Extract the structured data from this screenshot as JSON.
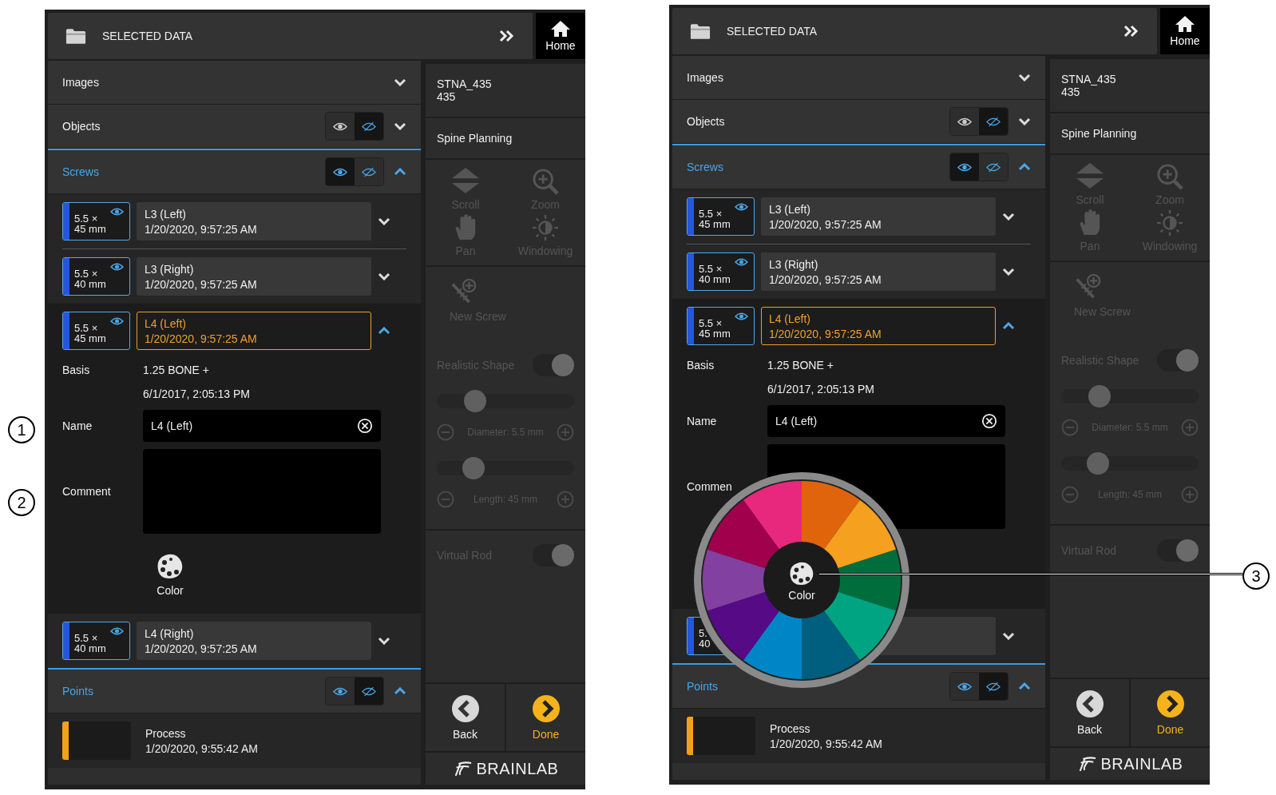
{
  "callouts": [
    {
      "label": "1"
    },
    {
      "label": "2"
    },
    {
      "label": "3"
    }
  ],
  "screens": [
    {
      "header": {
        "title": "SELECTED DATA",
        "home": "Home"
      },
      "sections": [
        {
          "title": "Images",
          "expanded": false
        },
        {
          "title": "Objects",
          "expanded": false,
          "shown": false
        },
        {
          "title": "Screws",
          "expanded": true,
          "shown": true
        }
      ],
      "screws": [
        {
          "size": "5.5 ×",
          "length": "45 mm",
          "name": "L3 (Left)",
          "date": "1/20/2020, 9:57:25 AM",
          "selected": false,
          "expanded": false
        },
        {
          "size": "5.5 ×",
          "length": "40 mm",
          "name": "L3 (Right)",
          "date": "1/20/2020, 9:57:25 AM",
          "selected": false,
          "expanded": false
        },
        {
          "size": "5.5 ×",
          "length": "45 mm",
          "name": "L4 (Left)",
          "date": "1/20/2020, 9:57:25 AM",
          "selected": true,
          "expanded": true
        },
        {
          "size": "5.5 ×",
          "length": "40 mm",
          "name": "L4 (Right)",
          "date": "1/20/2020, 9:57:25 AM",
          "selected": false,
          "expanded": false
        }
      ],
      "details": {
        "basis_label": "Basis",
        "basis_value": "1.25 BONE +",
        "basis_date": "6/1/2017, 2:05:13 PM",
        "name_label": "Name",
        "name_value": "L4 (Left)",
        "comment_label": "Comment",
        "color_label": "Color"
      },
      "points": {
        "title": "Points",
        "expanded": true,
        "shown": false,
        "items": [
          {
            "name": "Process",
            "date": "1/20/2020, 9:55:42 AM",
            "color": "#f5a01a"
          }
        ]
      },
      "side": {
        "patient_name": "STNA_435",
        "patient_id": "435",
        "workflow": "Spine Planning",
        "tools": [
          {
            "kind": "scroll",
            "label": "Scroll",
            "disabled": true
          },
          {
            "kind": "zoom",
            "label": "Zoom",
            "disabled": true
          },
          {
            "kind": "pan",
            "label": "Pan",
            "disabled": true
          },
          {
            "kind": "windowing",
            "label": "Windowing",
            "disabled": true
          }
        ],
        "new_screw": {
          "label": "New Screw",
          "disabled": true
        },
        "realistic_shape": {
          "label": "Realistic Shape",
          "on": true
        },
        "diameter": {
          "level": 0.28,
          "reading": "Diameter: 5.5 mm"
        },
        "length": {
          "level": 0.27,
          "reading": "Length: 45 mm"
        },
        "virtual_rod": {
          "label": "Virtual Rod",
          "on": true
        },
        "back": "Back",
        "done": "Done",
        "logo": "BRAINLAB"
      }
    },
    {
      "header": {
        "title": "SELECTED DATA",
        "home": "Home"
      },
      "sections": [
        {
          "title": "Images",
          "expanded": false
        },
        {
          "title": "Objects",
          "expanded": false,
          "shown": false
        },
        {
          "title": "Screws",
          "expanded": true,
          "shown": true
        }
      ],
      "screws": [
        {
          "size": "5.5 ×",
          "length": "45 mm",
          "name": "L3 (Left)",
          "date": "1/20/2020, 9:57:25 AM",
          "selected": false,
          "expanded": false
        },
        {
          "size": "5.5 ×",
          "length": "40 mm",
          "name": "L3 (Right)",
          "date": "1/20/2020, 9:57:25 AM",
          "selected": false,
          "expanded": false
        },
        {
          "size": "5.5 ×",
          "length": "45 mm",
          "name": "L4 (Left)",
          "date": "1/20/2020, 9:57:25 AM",
          "selected": true,
          "expanded": true
        },
        {
          "size": "5.",
          "length": "40",
          "selected": false,
          "expanded": false
        }
      ],
      "details": {
        "basis_label": "Basis",
        "basis_value": "1.25 BONE +",
        "basis_date": "6/1/2017, 2:05:13 PM",
        "name_label": "Name",
        "name_value": "L4 (Left)",
        "comment_label": "Commen"
      },
      "points": {
        "title": "Points",
        "expanded": true,
        "shown": false,
        "items": [
          {
            "name": "Process",
            "date": "1/20/2020, 9:55:42 AM",
            "color": "#f5a01a"
          }
        ]
      },
      "side": {
        "patient_name": "STNA_435",
        "patient_id": "435",
        "workflow": "Spine Planning",
        "tools": [
          {
            "kind": "scroll",
            "label": "Scroll",
            "disabled": true
          },
          {
            "kind": "zoom",
            "label": "Zoom",
            "disabled": true
          },
          {
            "kind": "pan",
            "label": "Pan",
            "disabled": true
          },
          {
            "kind": "windowing",
            "label": "Windowing",
            "disabled": true
          }
        ],
        "new_screw": {
          "label": "New Screw",
          "disabled": true
        },
        "realistic_shape": {
          "label": "Realistic Shape",
          "on": true
        },
        "diameter": {
          "level": 0.28,
          "reading": "Diameter: 5.5 mm"
        },
        "length": {
          "level": 0.27,
          "reading": "Length: 45 mm"
        },
        "virtual_rod": {
          "label": "Virtual Rod",
          "on": true
        },
        "back": "Back",
        "done": "Done",
        "logo": "BRAINLAB"
      },
      "color_wheel": {
        "label": "Color",
        "swatches": [
          {
            "color": "#e0640c"
          },
          {
            "color": "#f5a01e"
          },
          {
            "color": "#006e3c"
          },
          {
            "color": "#00a482"
          },
          {
            "color": "#005f7e"
          },
          {
            "color": "#0086c6"
          },
          {
            "color": "#560a86"
          },
          {
            "color": "#8240a0"
          },
          {
            "color": "#a0004c"
          },
          {
            "color": "#e8287c"
          }
        ]
      }
    }
  ]
}
